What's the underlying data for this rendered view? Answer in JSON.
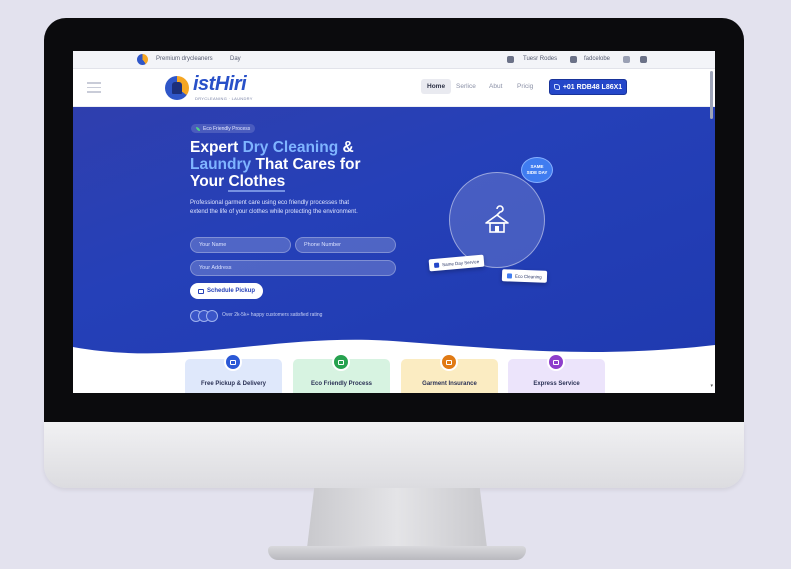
{
  "topbar": {
    "tagline": "Premium drycleaners",
    "day": "Day",
    "item1": "Tuesr Rodes",
    "item2": "fadcelobe"
  },
  "navbar": {
    "logo_text": "istHiri",
    "logo_sub": "DRYCLEANING · LAUNDRY",
    "links": [
      "Home",
      "Serlice",
      "Abut",
      "Pricig"
    ],
    "cta_label": "+01 RDB48 L86X1"
  },
  "hero": {
    "badge": "Eco Friendly Process",
    "headline_1": "Expert ",
    "headline_hl": "Dry Cleaning",
    "headline_2": " & ",
    "headline_3": "Laundry",
    "headline_4": " That Cares for Your ",
    "headline_5": "Clothes",
    "lead": "Professional garment care using eco friendly processes that extend the life of your clothes while protecting the environment.",
    "field_name": "Your Name",
    "field_phone": "Phone Number",
    "field_address": "Your Address",
    "submit_label": "Schedule Pickup",
    "trust_text": "Over 2k-5k+ happy customers satisfied rating",
    "chip_line1": "SAME",
    "chip_line2": "SIDE DAY",
    "card1": "Same Day Service",
    "card2": "Eco Cleaning"
  },
  "features": [
    {
      "label": "Free Pickup & Delivery",
      "bg": "#dfe8fb",
      "icon_bg": "#2b58d6"
    },
    {
      "label": "Eco Friendly Process",
      "bg": "#d7f3e1",
      "icon_bg": "#27a24f"
    },
    {
      "label": "Garment Insurance",
      "bg": "#fbecc2",
      "icon_bg": "#e07a14"
    },
    {
      "label": "Express Service",
      "bg": "#ece4fb",
      "icon_bg": "#8e3ecb"
    }
  ],
  "colors": {
    "primary": "#2447c9",
    "hero": "#2540b8",
    "highlight": "#7fb4ff"
  }
}
